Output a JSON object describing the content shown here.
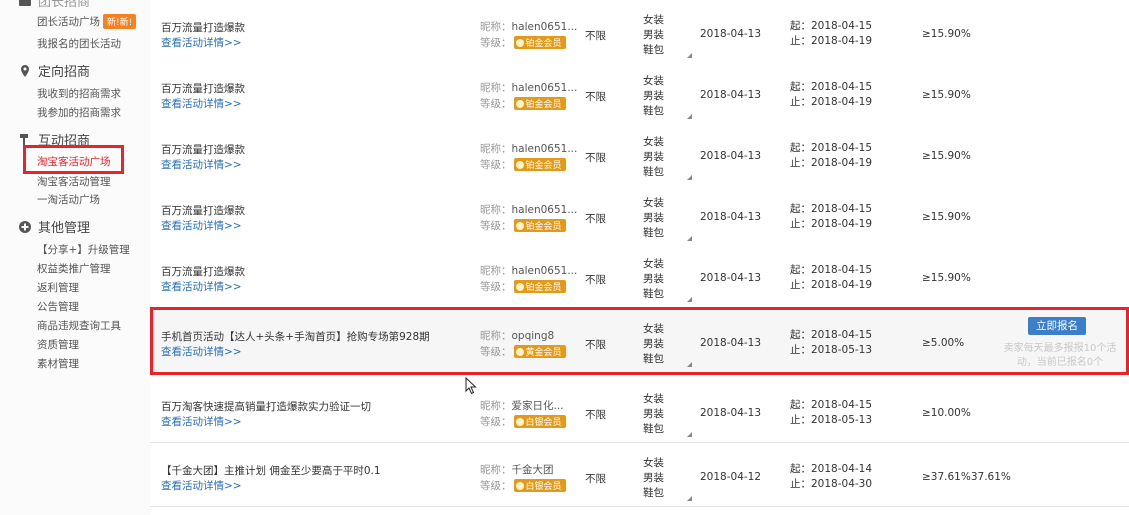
{
  "sidebar": {
    "top_items": [
      {
        "label": "团长活动广场",
        "badge": "新!新!"
      },
      {
        "label": "我报名的团长活动"
      }
    ],
    "groups": [
      {
        "title": "定向招商",
        "icon": "location-pin-icon",
        "items": [
          "我收到的招商需求",
          "我参加的招商需求"
        ]
      },
      {
        "title": "互动招商",
        "icon": "hammer-icon",
        "items": [
          "淘宝客活动广场",
          "淘宝客活动管理",
          "一淘活动广场"
        ]
      },
      {
        "title": "其他管理",
        "icon": "plus-circle-icon",
        "items": [
          "【分享+】升级管理",
          "权益类推广管理",
          "返利管理",
          "公告管理",
          "商品违规查询工具",
          "资质管理",
          "素材管理"
        ]
      }
    ]
  },
  "labels": {
    "nick": "昵称：",
    "level": "等级：",
    "start": "起：",
    "end": "止：",
    "detail_link": "查看活动详情>>",
    "apply_button": "立即报名",
    "apply_note": "卖家每天最多报报10个活动，当前已报名0个"
  },
  "rows": [
    {
      "title": "百万流量打造爆款",
      "nick": "halen0651...",
      "level": "铂金会员",
      "limit": "不限",
      "cats": [
        "女装",
        "男装",
        "鞋包"
      ],
      "date": "2018-04-13",
      "start": "2018-04-15",
      "end": "2018-04-19",
      "rate": "≥15.90%"
    },
    {
      "title": "百万流量打造爆款",
      "nick": "halen0651...",
      "level": "铂金会员",
      "limit": "不限",
      "cats": [
        "女装",
        "男装",
        "鞋包"
      ],
      "date": "2018-04-13",
      "start": "2018-04-15",
      "end": "2018-04-19",
      "rate": "≥15.90%"
    },
    {
      "title": "百万流量打造爆款",
      "nick": "halen0651...",
      "level": "铂金会员",
      "limit": "不限",
      "cats": [
        "女装",
        "男装",
        "鞋包"
      ],
      "date": "2018-04-13",
      "start": "2018-04-15",
      "end": "2018-04-19",
      "rate": "≥15.90%"
    },
    {
      "title": "百万流量打造爆款",
      "nick": "halen0651...",
      "level": "铂金会员",
      "limit": "不限",
      "cats": [
        "女装",
        "男装",
        "鞋包"
      ],
      "date": "2018-04-13",
      "start": "2018-04-15",
      "end": "2018-04-19",
      "rate": "≥15.90%"
    },
    {
      "title": "百万流量打造爆款",
      "nick": "halen0651...",
      "level": "铂金会员",
      "limit": "不限",
      "cats": [
        "女装",
        "男装",
        "鞋包"
      ],
      "date": "2018-04-13",
      "start": "2018-04-15",
      "end": "2018-04-19",
      "rate": "≥15.90%"
    },
    {
      "title": "手机首页活动【达人+头条+手淘首页】抢购专场第928期",
      "nick": "opqing8",
      "level": "黄金会员",
      "limit": "不限",
      "cats": [
        "女装",
        "男装",
        "鞋包"
      ],
      "date": "2018-04-13",
      "start": "2018-04-15",
      "end": "2018-05-13",
      "rate": "≥5.00%"
    },
    {
      "title": "百万淘客快速提高销量打造爆款实力验证一切",
      "nick": "爱家日化...",
      "level": "白银会员",
      "limit": "不限",
      "cats": [
        "女装",
        "男装",
        "鞋包"
      ],
      "date": "2018-04-13",
      "start": "2018-04-15",
      "end": "2018-05-13",
      "rate": "≥10.00%"
    },
    {
      "title": "【千金大团】主推计划 佣金至少要高于平时0.1",
      "nick": "千金大团",
      "level": "白银会员",
      "limit": "不限",
      "cats": [
        "女装",
        "男装",
        "鞋包"
      ],
      "date": "2018-04-12",
      "start": "2018-04-14",
      "end": "2018-04-30",
      "rate": "≥37.61%37.61%"
    }
  ]
}
